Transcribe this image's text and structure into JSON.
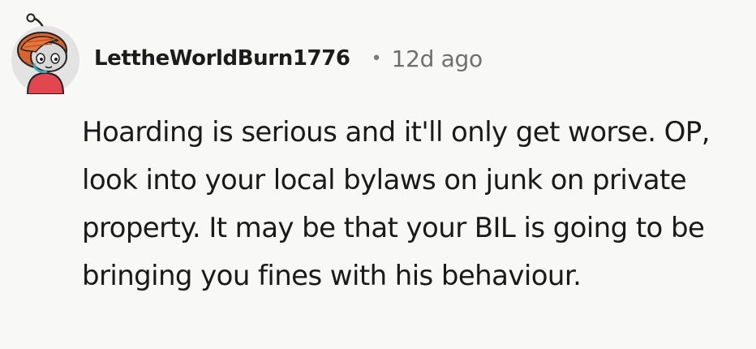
{
  "comment": {
    "avatar_icon": "user-avatar-icon",
    "username": "LettheWorldBurn1776",
    "separator": "•",
    "timestamp": "12d ago",
    "body": "Hoarding is serious and it'll only get worse. OP, look into your local bylaws on junk on private property. It may be that your BIL is going to be bringing you fines with his behaviour."
  },
  "colors": {
    "background": "#f8f8f6",
    "text": "#1a1a1a",
    "meta": "#6f6f6f",
    "avatar_bg": "#e3e3e3",
    "avatar_hair": "#d9642b",
    "avatar_shirt": "#e2474f"
  }
}
